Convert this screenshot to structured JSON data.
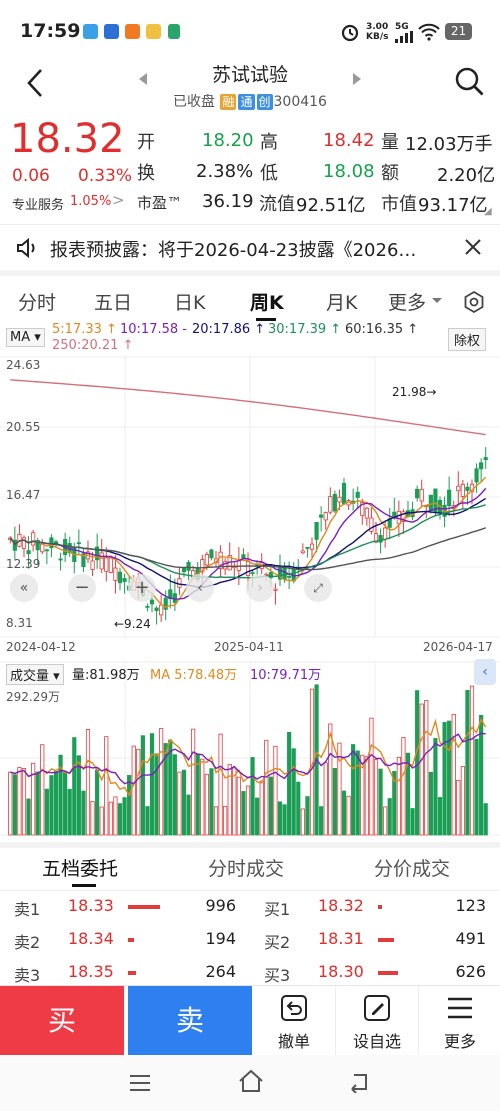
{
  "status": {
    "time": "17:59",
    "net_speed": "3.00\nKB/s",
    "net_speed_top": "3.00",
    "net_speed_bottom": "KB/s",
    "signal": "5G",
    "battery": "21"
  },
  "header": {
    "title": "苏试试验",
    "status": "已收盘",
    "tags": [
      "融",
      "通",
      "创"
    ],
    "code": "300416"
  },
  "quote": {
    "price": "18.32",
    "change": "0.06",
    "change_pct": "0.33%",
    "pro_label": "专业服务",
    "pro_value": "1.05%",
    "open_label": "开",
    "open": "18.20",
    "high_label": "高",
    "high": "18.42",
    "vol_label": "量",
    "vol": "12.03万手",
    "turnover_label": "换",
    "turnover": "2.38%",
    "low_label": "低",
    "low": "18.08",
    "amount_label": "额",
    "amount": "2.20亿",
    "pe_label": "市盈™",
    "pe": "36.19",
    "float_label": "流值",
    "float_cap": "92.51亿",
    "mcap_label": "市值",
    "mcap": "93.17亿"
  },
  "notice": {
    "text": "报表预披露：将于2026-04-23披露《2026…"
  },
  "tabs": [
    "分时",
    "五日",
    "日K",
    "周K",
    "月K",
    "更多"
  ],
  "tabs_active": "周K",
  "chart": {
    "ma_label": "MA",
    "ma5": "5:17.33 ↑",
    "ma10": "10:17.58 -",
    "ma20": "20:17.86 ↑",
    "ma30": "30:17.39 ↑",
    "ma60": "60:16.35 ↑",
    "ma250": "250:20.21 ↑",
    "fq": "除权",
    "y_ticks": [
      "24.63",
      "20.55",
      "16.47",
      "12.39",
      "8.31"
    ],
    "x_ticks": [
      "2024-04-12",
      "2025-04-11",
      "2026-04-17"
    ],
    "high_note": "21.98→",
    "low_note": "←9.24",
    "vol_label": "成交量",
    "vol_value": "量:81.98万",
    "vol_ma5": "MA 5:78.48万",
    "vol_ma10": "10:79.71万",
    "vol_max": "292.29万",
    "colors": {
      "up": "#e23b3b",
      "down": "#1b9e55",
      "ma5": "#e08a1e",
      "ma10": "#7a1fbf",
      "ma20": "#111177",
      "ma30": "#1e8e5a",
      "ma60": "#555555",
      "ma250": "#d4707a"
    }
  },
  "lowtabs": [
    "五档委托",
    "分时成交",
    "分价成交"
  ],
  "orderbook": {
    "sell": [
      {
        "label": "卖1",
        "price": "18.33",
        "qty": "996"
      },
      {
        "label": "卖2",
        "price": "18.34",
        "qty": "194"
      },
      {
        "label": "卖3",
        "price": "18.35",
        "qty": "264"
      }
    ],
    "buy": [
      {
        "label": "买1",
        "price": "18.32",
        "qty": "123"
      },
      {
        "label": "买2",
        "price": "18.31",
        "qty": "491"
      },
      {
        "label": "买3",
        "price": "18.30",
        "qty": "626"
      }
    ]
  },
  "bottom": {
    "buy": "买",
    "sell": "卖",
    "cancel": "撤单",
    "watch": "设自选",
    "more": "更多"
  }
}
